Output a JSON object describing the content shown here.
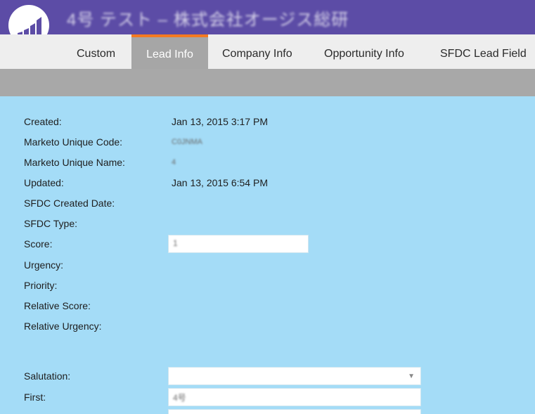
{
  "header": {
    "title": "4号 テスト – 株式会社オージス総研"
  },
  "tabs": [
    {
      "label": "Custom",
      "active": false
    },
    {
      "label": "Lead Info",
      "active": true
    },
    {
      "label": "Company Info",
      "active": false
    },
    {
      "label": "Opportunity Info",
      "active": false
    },
    {
      "label": "SFDC Lead Field",
      "active": false
    }
  ],
  "fields": {
    "created": {
      "label": "Created:",
      "value": "Jan 13, 2015 3:17 PM"
    },
    "unique_code": {
      "label": "Marketo Unique Code:",
      "value": "C0JNMA"
    },
    "unique_name": {
      "label": "Marketo Unique Name:",
      "value": "4"
    },
    "updated": {
      "label": "Updated:",
      "value": "Jan 13, 2015 6:54 PM"
    },
    "sfdc_created": {
      "label": "SFDC Created Date:",
      "value": ""
    },
    "sfdc_type": {
      "label": "SFDC Type:",
      "value": ""
    },
    "score": {
      "label": "Score:",
      "value": "1"
    },
    "urgency": {
      "label": "Urgency:",
      "value": ""
    },
    "priority": {
      "label": "Priority:",
      "value": ""
    },
    "relative_score": {
      "label": "Relative Score:",
      "value": ""
    },
    "relative_urgency": {
      "label": "Relative Urgency:",
      "value": ""
    },
    "salutation": {
      "label": "Salutation:",
      "value": ""
    },
    "first": {
      "label": "First:",
      "value": "4号"
    }
  },
  "colors": {
    "header": "#5c4ca6",
    "tab_active": "#a6a6a6",
    "tab_accent": "#f47a21",
    "panel": "#a4dcf7"
  },
  "icons": {
    "logo": "marketo-bars-logo",
    "dropdown": "chevron-down-icon"
  }
}
